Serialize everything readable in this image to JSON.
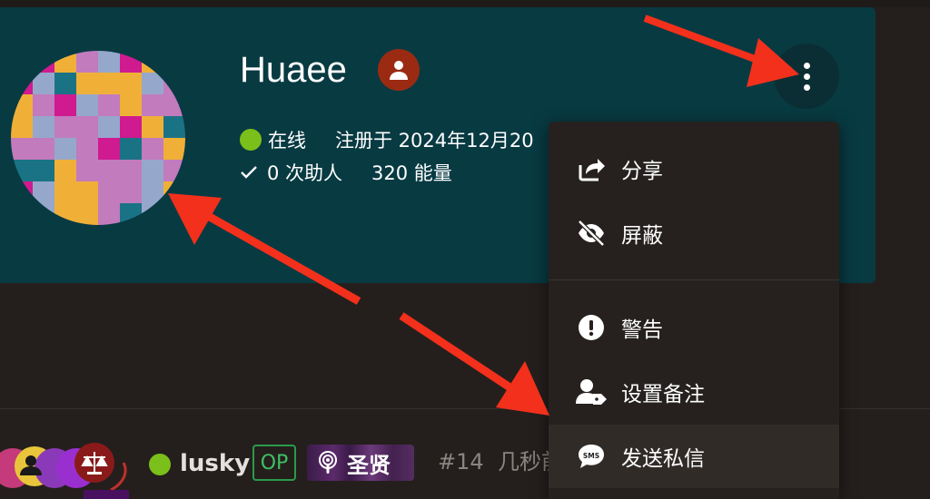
{
  "profile": {
    "username": "Huaee",
    "status": "在线",
    "registered": "注册于 2024年12月20",
    "helped": "0 次助人",
    "energy": "320 能量"
  },
  "menu": {
    "items": [
      {
        "label": "分享",
        "icon": "share-icon"
      },
      {
        "label": "屏蔽",
        "icon": "eye-slash-icon"
      },
      {
        "label": "警告",
        "icon": "exclamation-circle-icon"
      },
      {
        "label": "设置备注",
        "icon": "user-tag-icon"
      },
      {
        "label": "发送私信",
        "icon": "sms-icon"
      }
    ]
  },
  "post": {
    "author": "lusky",
    "op_badge": "OP",
    "title_badge": "圣贤",
    "number": "#14",
    "time": "几秒前"
  },
  "colors": {
    "card_bg": "#083a42",
    "page_bg": "#241f1d",
    "menu_bg": "#26211f",
    "online": "#7bbf1a",
    "role_badge": "#9b2a12",
    "op": "#2a9b4a",
    "arrow": "#f2301c"
  }
}
